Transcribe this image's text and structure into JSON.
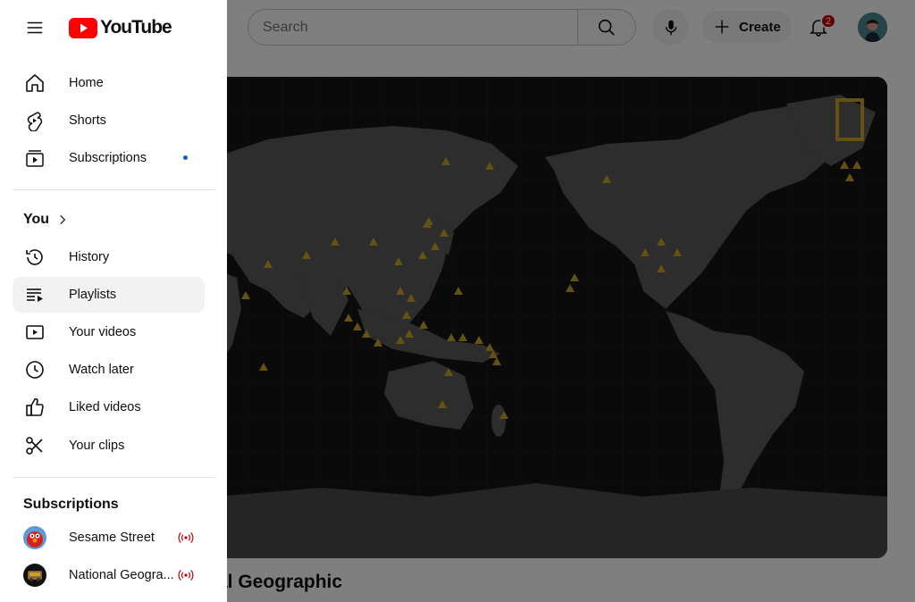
{
  "header": {
    "search_placeholder": "Search",
    "create_label": "Create",
    "notification_count": "2"
  },
  "logo": {
    "wordmark": "YouTube",
    "brand_color": "#ff0000"
  },
  "main": {
    "channel_name_fragment": "al Geographic",
    "banner_marker_color": "#c9a227"
  },
  "sidebar": {
    "primary": [
      {
        "label": "Home",
        "icon": "home-icon"
      },
      {
        "label": "Shorts",
        "icon": "shorts-icon"
      },
      {
        "label": "Subscriptions",
        "icon": "subscriptions-icon",
        "new_content_dot": true
      }
    ],
    "you_heading": "You",
    "you_items": [
      {
        "label": "History",
        "icon": "history-icon"
      },
      {
        "label": "Playlists",
        "icon": "playlists-icon",
        "selected": true
      },
      {
        "label": "Your videos",
        "icon": "your-videos-icon"
      },
      {
        "label": "Watch later",
        "icon": "clock-icon"
      },
      {
        "label": "Liked videos",
        "icon": "thumbs-up-icon"
      },
      {
        "label": "Your clips",
        "icon": "scissors-icon"
      }
    ],
    "subscriptions_heading": "Subscriptions",
    "subscriptions": [
      {
        "label": "Sesame Street",
        "live": true
      },
      {
        "label": "National Geogra...",
        "live": true
      }
    ]
  },
  "colors": {
    "overlay": "rgba(0,0,0,0.5)",
    "selected_bg": "#f2f2f2",
    "dot_blue": "#065fd4",
    "live_red": "#cc0000"
  }
}
